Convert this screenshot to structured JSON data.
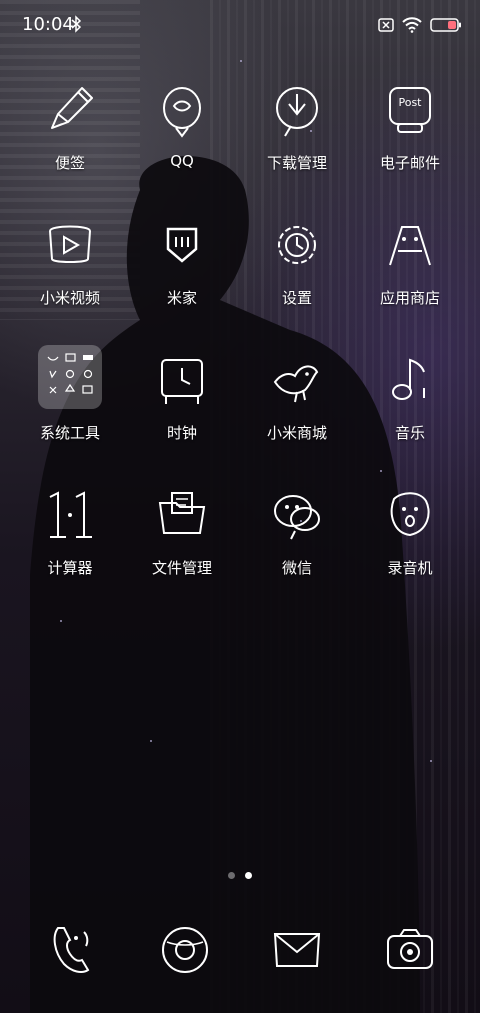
{
  "status_bar": {
    "time": "10:04",
    "icons": [
      "bluetooth-icon",
      "sim-x-icon",
      "wifi-icon",
      "battery-icon"
    ],
    "battery_color": "#ff6f7d"
  },
  "home": {
    "apps": [
      {
        "label": "便签",
        "icon": "pencil-icon"
      },
      {
        "label": "QQ",
        "icon": "penguin-icon"
      },
      {
        "label": "下载管理",
        "icon": "download-icon"
      },
      {
        "label": "电子邮件",
        "icon": "mailbox-icon"
      },
      {
        "label": "小米视频",
        "icon": "video-play-icon"
      },
      {
        "label": "米家",
        "icon": "mijia-icon"
      },
      {
        "label": "设置",
        "icon": "gear-icon"
      },
      {
        "label": "应用商店",
        "icon": "app-store-icon"
      },
      {
        "label": "系统工具",
        "icon": "folder-icon"
      },
      {
        "label": "时钟",
        "icon": "clock-icon"
      },
      {
        "label": "小米商城",
        "icon": "bird-icon"
      },
      {
        "label": "音乐",
        "icon": "music-note-icon"
      },
      {
        "label": "计算器",
        "icon": "calculator-icon"
      },
      {
        "label": "文件管理",
        "icon": "folder-file-icon"
      },
      {
        "label": "微信",
        "icon": "wechat-icon"
      },
      {
        "label": "录音机",
        "icon": "recorder-icon"
      }
    ]
  },
  "page_indicator": {
    "pages": 2,
    "current": 2
  },
  "dock": [
    {
      "icon": "phone-icon"
    },
    {
      "icon": "browser-icon"
    },
    {
      "icon": "message-icon"
    },
    {
      "icon": "camera-icon"
    }
  ]
}
